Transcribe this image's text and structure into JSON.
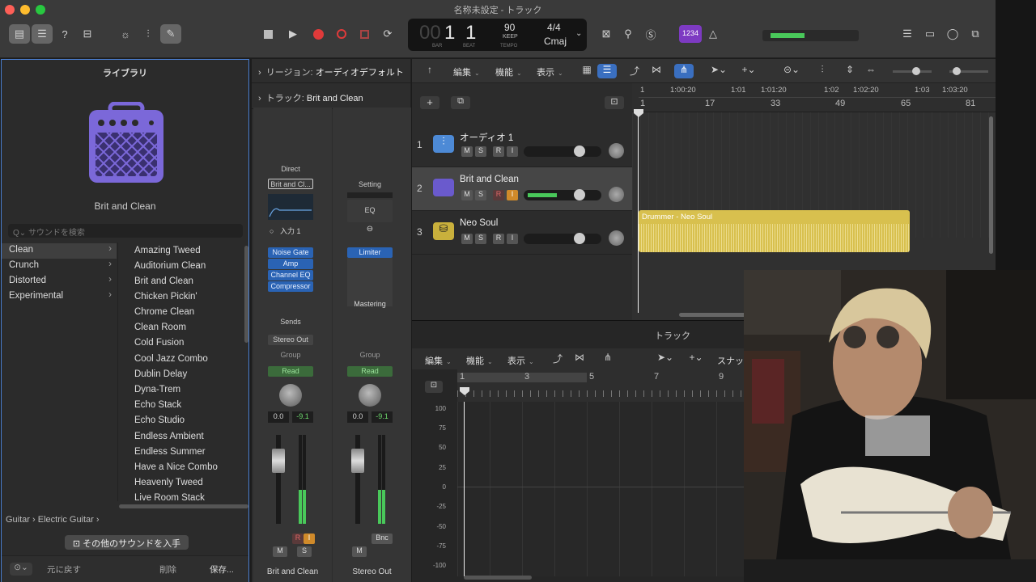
{
  "window": {
    "title": "名称未設定 - トラック"
  },
  "lcd": {
    "bar": "1",
    "beat": "1",
    "bar_label": "BAR",
    "beat_label": "BEAT",
    "tempo": "90",
    "tempo_sub": "KEEP",
    "tempo_label": "TEMPO",
    "signature": "4/4",
    "key": "Cmaj",
    "count_in": "1234"
  },
  "library": {
    "title": "ライブラリ",
    "selected_name": "Brit and Clean",
    "search_placeholder": "サウンドを検索",
    "categories": [
      "Clean",
      "Crunch",
      "Distorted",
      "Experimental"
    ],
    "sounds": [
      "Amazing Tweed",
      "Auditorium Clean",
      "Brit and Clean",
      "Chicken Pickin'",
      "Chrome Clean",
      "Clean Room",
      "Cold Fusion",
      "Cool Jazz Combo",
      "Dublin Delay",
      "Dyna-Trem",
      "Echo Stack",
      "Echo Studio",
      "Endless Ambient",
      "Endless Summer",
      "Have a Nice Combo",
      "Heavenly Tweed",
      "Live Room Stack"
    ],
    "path_1": "Guitar",
    "path_2": "Electric Guitar",
    "get_more": "その他のサウンドを入手",
    "revert": "元に戻す",
    "delete": "削除",
    "save": "保存..."
  },
  "inspector": {
    "region_label": "リージョン:",
    "region_value": "オーディオデフォルト",
    "track_label": "トラック:",
    "track_value": "Brit and Clean",
    "strip1": {
      "direct": "Direct",
      "patch": "Brit and Cl...",
      "input": "入力 1",
      "plugins": [
        "Noise Gate",
        "Amp",
        "Channel EQ",
        "Compressor"
      ],
      "sends": "Sends",
      "output": "Stereo Out",
      "group": "Group",
      "automation": "Read",
      "vol": "0.0",
      "peak": "-9.1",
      "m": "M",
      "s": "S",
      "r": "R",
      "i": "I",
      "name": "Brit and Clean"
    },
    "strip2": {
      "setting": "Setting",
      "eq": "EQ",
      "plugins": [
        "Limiter"
      ],
      "mastering": "Mastering",
      "group": "Group",
      "automation": "Read",
      "vol": "0.0",
      "peak": "-9.1",
      "bnc": "Bnc",
      "m": "M",
      "name": "Stereo Out"
    }
  },
  "tracks_toolbar": {
    "edit": "編集",
    "function": "機能",
    "view": "表示"
  },
  "ruler": {
    "bars": [
      "1",
      "17",
      "33",
      "49",
      "65",
      "81"
    ],
    "times": [
      "1",
      "1:00:20",
      "1:01",
      "1:01:20",
      "1:02",
      "1:02:20",
      "1:03",
      "1:03:20"
    ]
  },
  "tracks": [
    {
      "num": "1",
      "name": "オーディオ 1",
      "m": "M",
      "s": "S",
      "r": "R",
      "i": "I",
      "volume": 0.75
    },
    {
      "num": "2",
      "name": "Brit and Clean",
      "m": "M",
      "s": "S",
      "r": "R",
      "i": "I",
      "volume": 0.75
    },
    {
      "num": "3",
      "name": "Neo Soul",
      "m": "M",
      "s": "S",
      "r": "R",
      "i": "I",
      "volume": 0.75
    }
  ],
  "region": {
    "name": "Drummer - Neo Soul"
  },
  "editor": {
    "title": "トラック",
    "edit": "編集",
    "function": "機能",
    "view": "表示",
    "snap": "スナッ",
    "bars": [
      "1",
      "3",
      "5",
      "7",
      "9"
    ],
    "y_labels": [
      "100",
      "75",
      "50",
      "25",
      "0",
      "-25",
      "-50",
      "-75",
      "-100"
    ]
  },
  "colors": {
    "accent": "#3a6fc0",
    "region": "#d8c04e",
    "library_icon": "#7b68d9",
    "record": "#e03a3a"
  }
}
